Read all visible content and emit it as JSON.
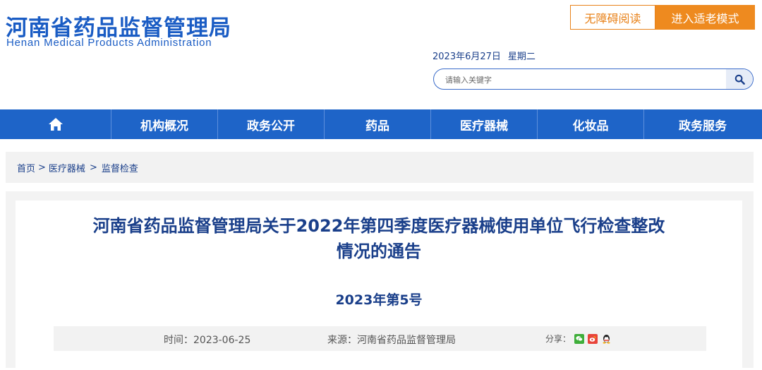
{
  "header": {
    "brand_cn": "河南省药品监督管理局",
    "brand_en": "Henan Medical Products Administration",
    "accessible_label": "无障碍阅读",
    "elder_mode_label": "进入适老模式",
    "date": "2023年6月27日",
    "weekday": "星期二",
    "search_placeholder": "请输入关键字"
  },
  "nav": {
    "home_icon": "home-icon",
    "items": [
      "机构概况",
      "政务公开",
      "药品",
      "医疗器械",
      "化妆品",
      "政务服务"
    ]
  },
  "breadcrumb": {
    "home": "首页",
    "level1": "医疗器械",
    "level2": "监督检查",
    "separator": ">"
  },
  "article": {
    "title_line1": "河南省药品监督管理局关于2022年第四季度医疗器械使用单位飞行检查整改",
    "title_line2": "情况的通告",
    "doc_number": "2023年第5号",
    "time_label": "时间：",
    "time_value": "2023-06-25",
    "source_label": "来源：",
    "source_value": "河南省药品监督管理局",
    "share_label": "分享："
  },
  "colors": {
    "brand_blue": "#1a5cc4",
    "nav_blue": "#1e64c8",
    "accent_orange": "#ee8a1f",
    "title_navy": "#1a3f8a"
  }
}
